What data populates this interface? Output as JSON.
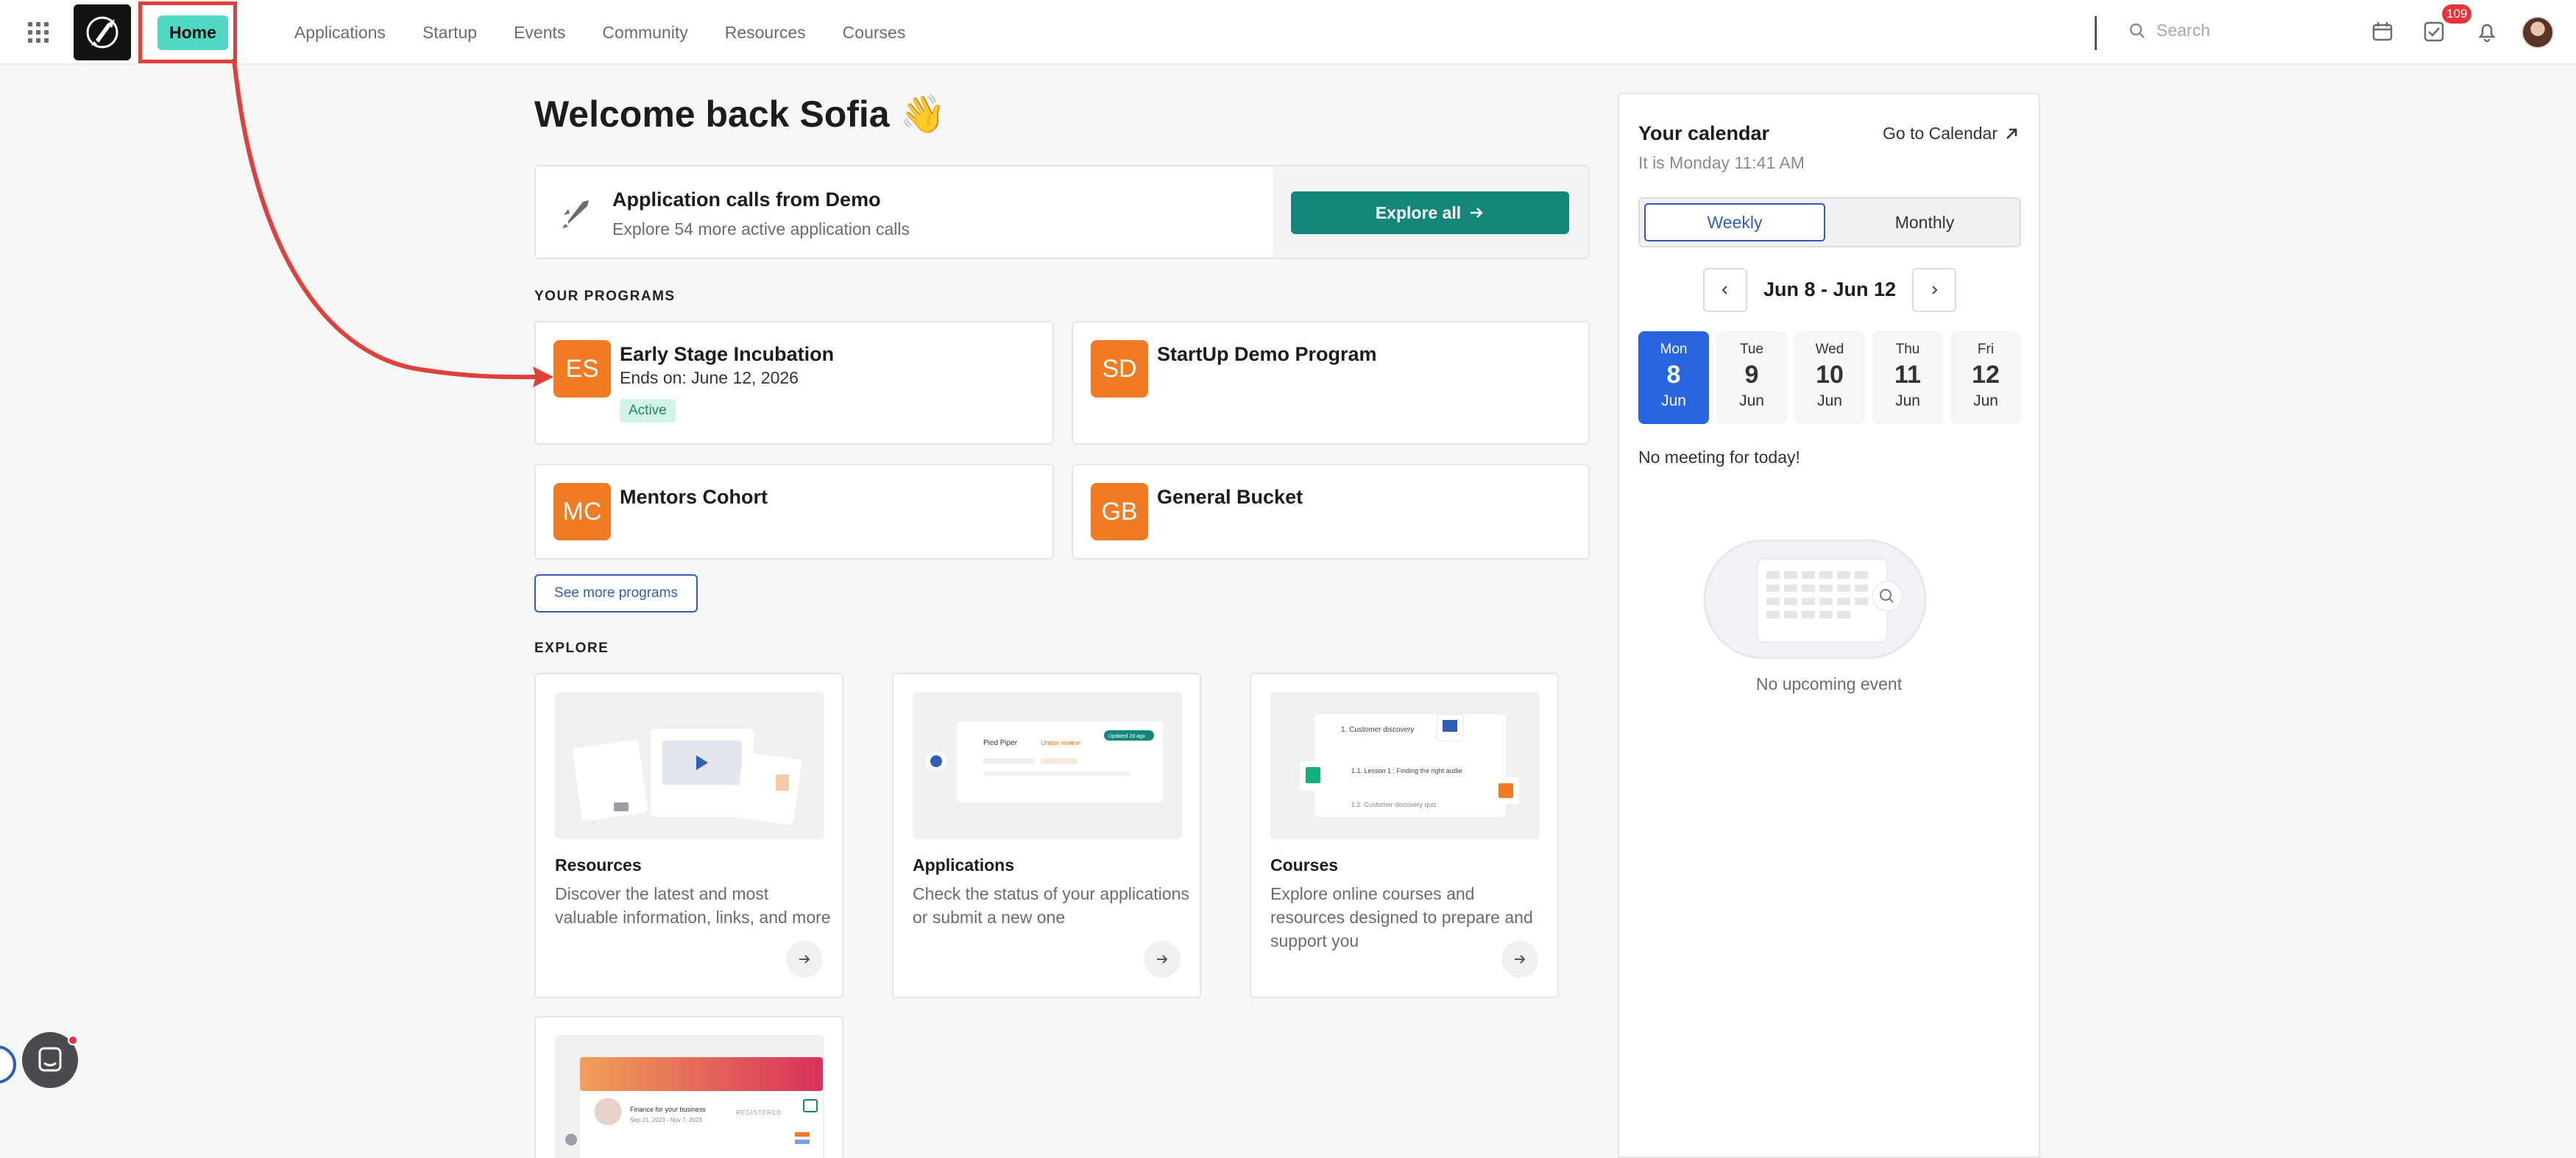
{
  "nav": {
    "home": "Home",
    "items": [
      "Applications",
      "Startup",
      "Events",
      "Community",
      "Resources",
      "Courses"
    ],
    "search_placeholder": "Search",
    "task_badge": "109"
  },
  "welcome": "Welcome back Sofia 👋",
  "app_calls": {
    "title": "Application calls from Demo",
    "subtitle": "Explore 54 more active application calls",
    "button": "Explore all"
  },
  "programs": {
    "label": "YOUR PROGRAMS",
    "items": [
      {
        "initials": "ES",
        "name": "Early Stage Incubation",
        "ends": "Ends on: June 12, 2026",
        "status": "Active"
      },
      {
        "initials": "SD",
        "name": "StartUp Demo Program"
      },
      {
        "initials": "MC",
        "name": "Mentors Cohort"
      },
      {
        "initials": "GB",
        "name": "General Bucket"
      }
    ],
    "see_more": "See more programs"
  },
  "explore": {
    "label": "EXPLORE",
    "cards": [
      {
        "title": "Resources",
        "desc": "Discover the latest and most valuable information, links, and more"
      },
      {
        "title": "Applications",
        "desc": "Check the status of your applications or submit a new one"
      },
      {
        "title": "Courses",
        "desc": "Explore online courses and resources designed to prepare and support you"
      }
    ],
    "preview_courses": [
      "1. Customer discovery",
      "1.1. Lesson 1 : Finding the right audie",
      "1.2. Customer discovery quiz"
    ],
    "preview_apps": [
      "Pied Piper",
      "Under review",
      "Updated 2d ago"
    ],
    "preview_event": [
      "Finance for your business",
      "Sep 21, 2023 - Nov 7, 2023",
      "REGISTERED"
    ]
  },
  "calendar": {
    "title": "Your calendar",
    "link": "Go to Calendar",
    "time": "It is Monday 11:41 AM",
    "weekly": "Weekly",
    "monthly": "Monthly",
    "week_label": "Jun 8 - Jun 12",
    "days": [
      {
        "dow": "Mon",
        "num": "8",
        "mon": "Jun"
      },
      {
        "dow": "Tue",
        "num": "9",
        "mon": "Jun"
      },
      {
        "dow": "Wed",
        "num": "10",
        "mon": "Jun"
      },
      {
        "dow": "Thu",
        "num": "11",
        "mon": "Jun"
      },
      {
        "dow": "Fri",
        "num": "12",
        "mon": "Jun"
      }
    ],
    "no_meeting": "No meeting for today!",
    "no_event": "No upcoming event"
  },
  "colors": {
    "brand_teal": "#14877a",
    "home_highlight": "#4fd8c4",
    "annotation_red": "#e0403a",
    "active_day": "#2764e0",
    "program_orange": "#f07b22"
  }
}
